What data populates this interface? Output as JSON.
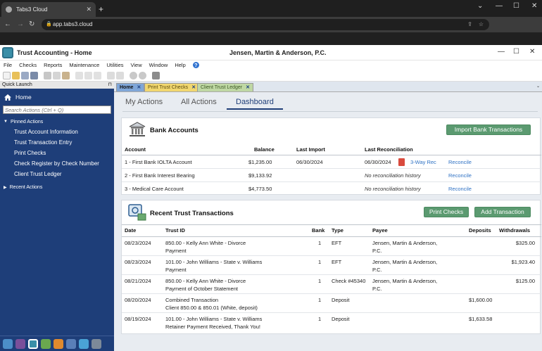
{
  "browser": {
    "tab_title": "Tabs3 Cloud",
    "tab_close": "✕",
    "new_tab": "+",
    "url": "app.tabs3.cloud",
    "win_min": "⌄",
    "win_min2": "—",
    "win_max": "☐",
    "win_close": "✕"
  },
  "app": {
    "title": "Trust Accounting - Home",
    "firm": "Jensen, Martin & Anderson, P.C.",
    "menu": [
      "File",
      "Checks",
      "Reports",
      "Maintenance",
      "Utilities",
      "View",
      "Window",
      "Help"
    ]
  },
  "sidebar": {
    "header": "Quick Launch",
    "home": "Home",
    "search_placeholder": "Search Actions (Ctrl + Q)",
    "pinned_label": "Pinned Actions",
    "pinned": [
      "Trust Account Information",
      "Trust Transaction Entry",
      "Print Checks",
      "Check Register by Check Number",
      "Client Trust Ledger"
    ],
    "recent_label": "Recent Actions"
  },
  "doc_tabs": [
    {
      "label": "Home",
      "color": "#7fa6d8"
    },
    {
      "label": "Print Trust Checks",
      "color": "#f1d76f"
    },
    {
      "label": "Client Trust Ledger",
      "color": "#bfd8a4"
    }
  ],
  "nav_tabs": [
    "My Actions",
    "All Actions",
    "Dashboard"
  ],
  "bank": {
    "title": "Bank Accounts",
    "import_btn": "Import Bank Transactions",
    "headers": {
      "account": "Account",
      "balance": "Balance",
      "last_import": "Last Import",
      "last_recon": "Last Reconciliation"
    },
    "rows": [
      {
        "account": "1 - First Bank IOLTA Account",
        "balance": "$1,235.00",
        "last_import": "06/30/2024",
        "last_recon": "06/30/2024",
        "threeway": "3-Way Rec",
        "reconcile": "Reconcile"
      },
      {
        "account": "2 - First Bank Interest Bearing",
        "balance": "$9,133.92",
        "last_import": "",
        "last_recon": "No reconciliation history",
        "threeway": "",
        "reconcile": "Reconcile"
      },
      {
        "account": "3 - Medical Care Account",
        "balance": "$4,773.50",
        "last_import": "",
        "last_recon": "No reconciliation history",
        "threeway": "",
        "reconcile": "Reconcile"
      }
    ]
  },
  "trans": {
    "title": "Recent Trust Transactions",
    "print_btn": "Print Checks",
    "add_btn": "Add Transaction",
    "headers": {
      "date": "Date",
      "trust_id": "Trust ID",
      "bank": "Bank",
      "type": "Type",
      "payee": "Payee",
      "deposits": "Deposits",
      "withdrawals": "Withdrawals"
    },
    "rows": [
      {
        "date": "08/23/2024",
        "id1": "850.00 - Kelly Ann White - Divorce",
        "id2": "Payment",
        "bank": "1",
        "type": "EFT",
        "payee1": "Jensen, Martin & Anderson,",
        "payee2": "P.C.",
        "deposits": "",
        "withdrawals": "$325.00"
      },
      {
        "date": "08/23/2024",
        "id1": "101.00 - John Williams - State v. Williams",
        "id2": "Payment",
        "bank": "1",
        "type": "EFT",
        "payee1": "Jensen, Martin & Anderson,",
        "payee2": "P.C.",
        "deposits": "",
        "withdrawals": "$1,923.40"
      },
      {
        "date": "08/21/2024",
        "id1": "850.00 - Kelly Ann White - Divorce",
        "id2": "Payment of October Statement",
        "bank": "1",
        "type": "Check #45340",
        "payee1": "Jensen, Martin & Anderson,",
        "payee2": "P.C.",
        "deposits": "",
        "withdrawals": "$125.00"
      },
      {
        "date": "08/20/2024",
        "id1": "Combined Transaction",
        "id2": "Client 850.00 & 850.01 (White, deposit)",
        "bank": "1",
        "type": "Deposit",
        "payee1": "",
        "payee2": "",
        "deposits": "$1,600.00",
        "withdrawals": ""
      },
      {
        "date": "08/19/2024",
        "id1": "101.00 - John Williams - State v. Williams",
        "id2": "Retainer Payment Received, Thank You!",
        "bank": "1",
        "type": "Deposit",
        "payee1": "",
        "payee2": "",
        "deposits": "$1,633.58",
        "withdrawals": ""
      }
    ]
  }
}
